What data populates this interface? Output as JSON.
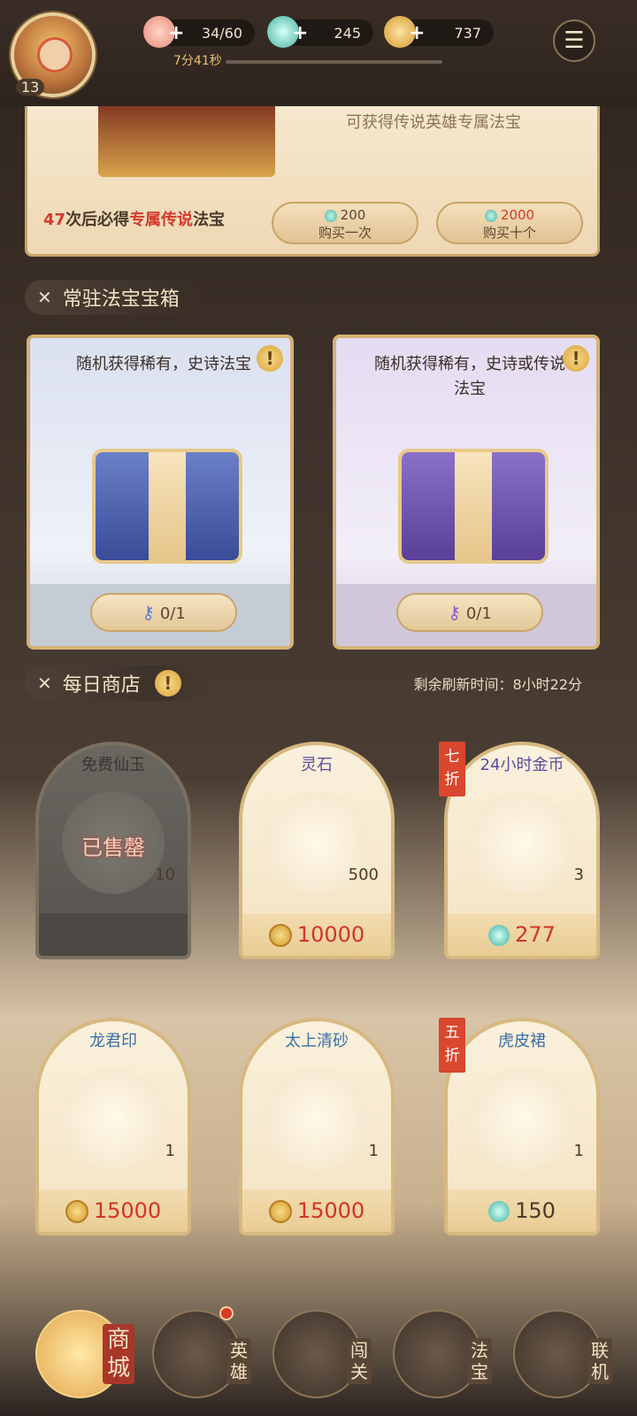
{
  "header": {
    "level": "13",
    "stamina": "34/60",
    "gems": "245",
    "coins": "737",
    "timer": "7分41秒",
    "plus": "+"
  },
  "legend_banner": {
    "subtitle": "可获得传说英雄专属法宝",
    "pity_count": "47",
    "pity_mid": "次后必得",
    "pity_highlight": "专属传说",
    "pity_end": "法宝",
    "buy_one_price": "200",
    "buy_one_label": "购买一次",
    "buy_ten_price": "2000",
    "buy_ten_label": "购买十个"
  },
  "resident_boxes": {
    "title": "常驻法宝宝箱",
    "boxes": [
      {
        "desc": "随机获得稀有，史诗法宝",
        "keys": "0/1",
        "accent": "#3a4c98"
      },
      {
        "desc": "随机获得稀有，史诗或传说法宝",
        "keys": "0/1",
        "accent": "#5a3f98"
      }
    ]
  },
  "daily_shop": {
    "title": "每日商店",
    "refresh_label": "剩余刷新时间：8小时22分",
    "sold_out": "已售罄",
    "items": [
      {
        "name": "免费仙玉",
        "qty": "10",
        "price": "",
        "currency": "",
        "discount": "",
        "sold": true
      },
      {
        "name": "灵石",
        "qty": "500",
        "price": "10000",
        "currency": "coin",
        "discount": ""
      },
      {
        "name": "24小时金币",
        "qty": "3",
        "price": "277",
        "currency": "gem",
        "discount": "七折"
      },
      {
        "name": "龙君印",
        "qty": "1",
        "price": "15000",
        "currency": "coin",
        "discount": ""
      },
      {
        "name": "太上清砂",
        "qty": "1",
        "price": "15000",
        "currency": "coin",
        "discount": ""
      },
      {
        "name": "虎皮裙",
        "qty": "1",
        "price": "150",
        "currency": "gem",
        "discount": "五折"
      }
    ]
  },
  "nav": {
    "items": [
      {
        "label": "商城",
        "active": true
      },
      {
        "label": "英雄"
      },
      {
        "label": "闯关"
      },
      {
        "label": "法宝"
      },
      {
        "label": "联机"
      }
    ]
  }
}
